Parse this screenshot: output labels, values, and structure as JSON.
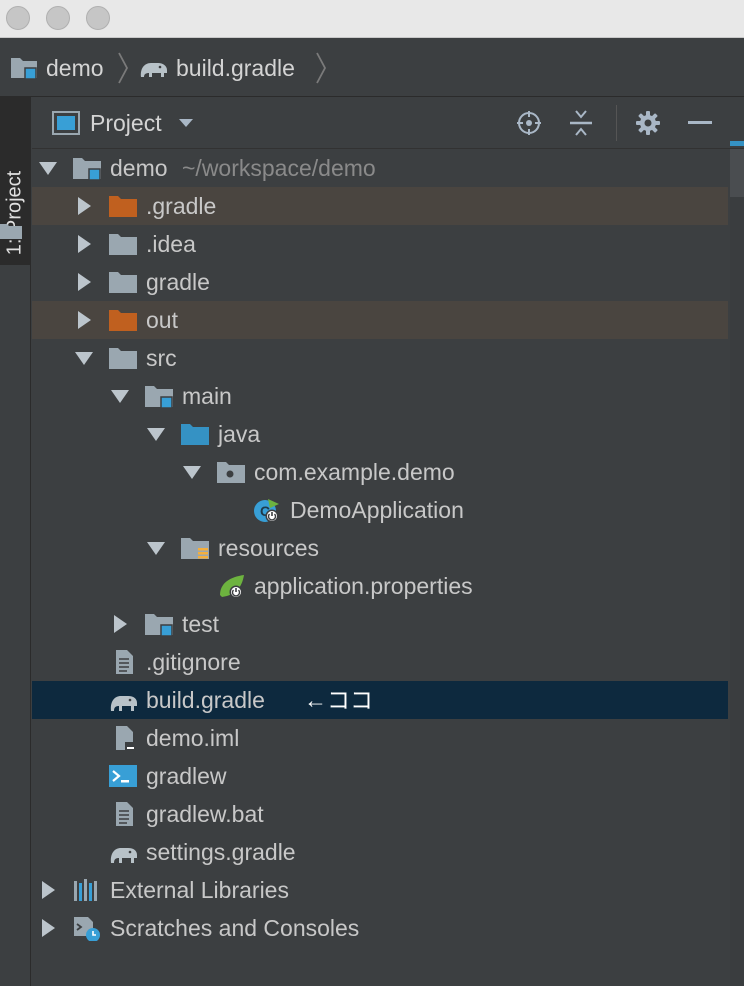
{
  "breadcrumb": {
    "items": [
      {
        "label": "demo",
        "icon": "module-folder-icon"
      },
      {
        "label": "build.gradle",
        "icon": "gradle-elephant-icon"
      }
    ]
  },
  "side_tab": {
    "label": "1: Project"
  },
  "panel": {
    "title": "Project",
    "actions": [
      "locate-icon",
      "collapse-all-icon",
      "gear-icon",
      "hide-icon"
    ]
  },
  "tree": [
    {
      "label": "demo",
      "sub": "~/workspace/demo",
      "depth": 0,
      "arrow": "down",
      "icon": "module-folder-icon"
    },
    {
      "label": ".gradle",
      "depth": 1,
      "arrow": "right",
      "icon": "excluded-folder-icon",
      "excluded": true
    },
    {
      "label": ".idea",
      "depth": 1,
      "arrow": "right",
      "icon": "folder-icon"
    },
    {
      "label": "gradle",
      "depth": 1,
      "arrow": "right",
      "icon": "folder-icon"
    },
    {
      "label": "out",
      "depth": 1,
      "arrow": "right",
      "icon": "excluded-folder-icon",
      "excluded": true
    },
    {
      "label": "src",
      "depth": 1,
      "arrow": "down",
      "icon": "folder-icon"
    },
    {
      "label": "main",
      "depth": 2,
      "arrow": "down",
      "icon": "module-folder-icon"
    },
    {
      "label": "java",
      "depth": 3,
      "arrow": "down",
      "icon": "source-folder-icon"
    },
    {
      "label": "com.example.demo",
      "depth": 4,
      "arrow": "down",
      "icon": "package-icon"
    },
    {
      "label": "DemoApplication",
      "depth": 5,
      "arrow": "",
      "icon": "spring-boot-class-icon"
    },
    {
      "label": "resources",
      "depth": 3,
      "arrow": "down",
      "icon": "resources-folder-icon"
    },
    {
      "label": "application.properties",
      "depth": 4,
      "arrow": "",
      "icon": "spring-properties-icon"
    },
    {
      "label": "test",
      "depth": 2,
      "arrow": "right",
      "icon": "module-folder-icon"
    },
    {
      "label": ".gitignore",
      "depth": 1,
      "arrow": "",
      "icon": "text-file-icon"
    },
    {
      "label": "build.gradle",
      "depth": 1,
      "arrow": "",
      "icon": "gradle-elephant-icon",
      "selected": true,
      "note": "←ココ"
    },
    {
      "label": "demo.iml",
      "depth": 1,
      "arrow": "",
      "icon": "iml-file-icon"
    },
    {
      "label": "gradlew",
      "depth": 1,
      "arrow": "",
      "icon": "shell-script-icon"
    },
    {
      "label": "gradlew.bat",
      "depth": 1,
      "arrow": "",
      "icon": "text-file-icon"
    },
    {
      "label": "settings.gradle",
      "depth": 1,
      "arrow": "",
      "icon": "gradle-elephant-icon"
    },
    {
      "label": "External Libraries",
      "depth": 0,
      "arrow": "right",
      "icon": "libraries-icon"
    },
    {
      "label": "Scratches and Consoles",
      "depth": 0,
      "arrow": "right",
      "icon": "scratches-icon"
    }
  ],
  "colors": {
    "background": "#3c3f41",
    "selection": "#0d293e",
    "excluded_row": "#4a4540",
    "excluded_folder": "#c0601f",
    "folder": "#9aa7b0",
    "source_folder": "#3592c4",
    "accent": "#389fd6",
    "resources_marker": "#f4af3d",
    "spring_green": "#6db33f"
  }
}
